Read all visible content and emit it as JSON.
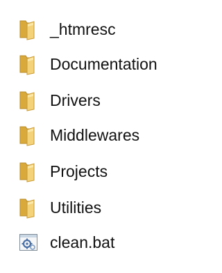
{
  "explorer": {
    "items": [
      {
        "type": "folder",
        "name": "_htmresc",
        "icon": "folder-icon"
      },
      {
        "type": "folder",
        "name": "Documentation",
        "icon": "folder-icon"
      },
      {
        "type": "folder",
        "name": "Drivers",
        "icon": "folder-icon"
      },
      {
        "type": "folder",
        "name": "Middlewares",
        "icon": "folder-icon"
      },
      {
        "type": "folder",
        "name": "Projects",
        "icon": "folder-icon"
      },
      {
        "type": "folder",
        "name": "Utilities",
        "icon": "folder-icon"
      },
      {
        "type": "file",
        "name": "clean.bat",
        "icon": "batch-file-icon"
      }
    ]
  },
  "colors": {
    "folder_front": "#f3d27a",
    "folder_back": "#d9a93b",
    "folder_edge": "#b88a2a",
    "text": "#111111"
  }
}
